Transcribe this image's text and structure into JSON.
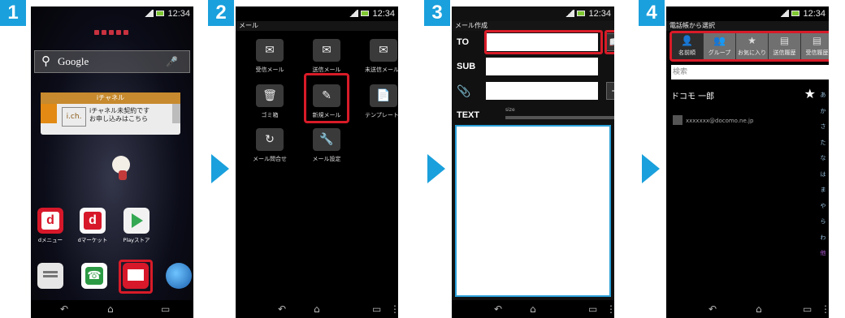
{
  "steps": [
    "1",
    "2",
    "3",
    "4"
  ],
  "status": {
    "time": "12:34"
  },
  "screen1": {
    "search_label": "Google",
    "widget_title": "iチャネル",
    "widget_logo": "i.ch.",
    "widget_line1": "iチャネル未契約です",
    "widget_line2": "お申し込みはこちら",
    "apps": [
      "dメニュー",
      "dマーケット",
      "Playストア"
    ]
  },
  "screen2": {
    "title": "メール",
    "items": [
      "受信メール",
      "送信メール",
      "未送信メール",
      "ゴミ箱",
      "新規メール",
      "テンプレート",
      "メール問合せ",
      "メール設定"
    ]
  },
  "screen3": {
    "title": "メール作成",
    "to_label": "TO",
    "sub_label": "SUB",
    "text_label": "TEXT",
    "size_label": "size"
  },
  "screen4": {
    "title": "電話帳から選択",
    "tabs": [
      "名前順",
      "グループ",
      "お気に入り",
      "送信履歴",
      "受信履歴"
    ],
    "search_placeholder": "検索",
    "contact_name": "ドコモ 一郎",
    "contact_email": "xxxxxxx@docomo.ne.jp",
    "index": [
      "あ",
      "か",
      "さ",
      "た",
      "な",
      "は",
      "ま",
      "や",
      "ら",
      "わ",
      "他"
    ]
  }
}
